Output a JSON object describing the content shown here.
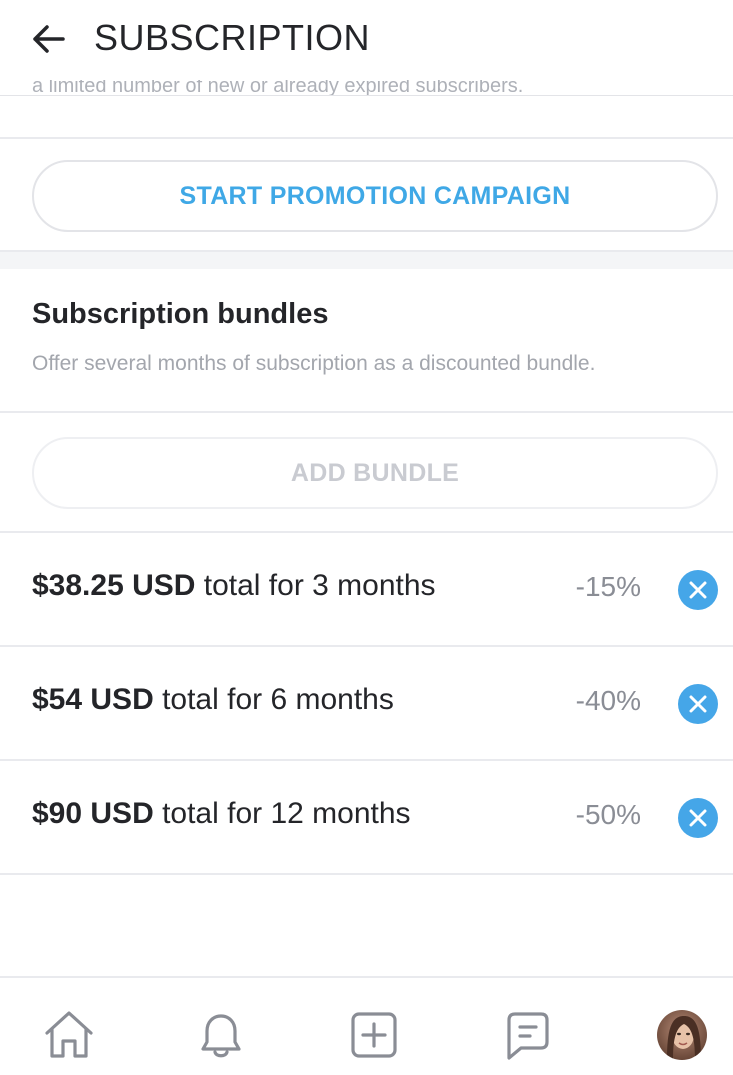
{
  "header": {
    "title": "SUBSCRIPTION",
    "back_icon": "arrow-left-icon"
  },
  "promotion": {
    "cut_off_text": "a limited number of new or already expired subscribers.",
    "button_label": "START PROMOTION CAMPAIGN"
  },
  "bundles_section": {
    "title": "Subscription bundles",
    "description": "Offer several months of subscription as a discounted bundle.",
    "add_button_label": "ADD BUNDLE",
    "items": [
      {
        "price": "$38.25 USD",
        "text": " total for 3 months",
        "discount": "-15%"
      },
      {
        "price": "$54 USD",
        "text": " total for 6 months",
        "discount": "-40%"
      },
      {
        "price": "$90 USD",
        "text": " total for 12 months",
        "discount": "-50%"
      }
    ]
  },
  "bottom_nav": {
    "items": [
      "home-icon",
      "bell-icon",
      "add-post-icon",
      "messages-icon",
      "avatar"
    ]
  },
  "colors": {
    "accent": "#3fa8e6",
    "remove_button": "#45a6e8",
    "text_primary": "#242529",
    "text_muted": "#a3a6ad",
    "divider": "#e9eaee"
  }
}
